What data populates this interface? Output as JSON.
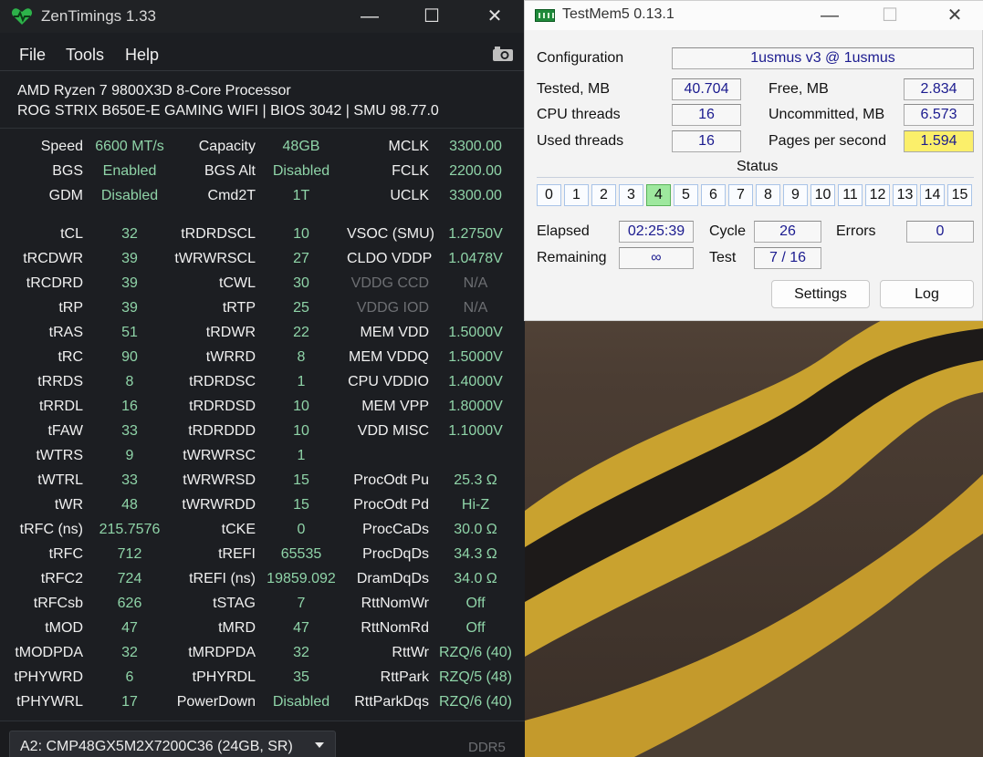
{
  "zentimings": {
    "title": "ZenTimings 1.33",
    "window_controls": {
      "minimize": "—",
      "maximize": "☐",
      "close": "✕"
    },
    "menu": [
      "File",
      "Tools",
      "Help"
    ],
    "cpu_name": "AMD Ryzen 7 9800X3D 8-Core Processor",
    "board_info": "ROG STRIX B650E-E GAMING WIFI | BIOS 3042 | SMU 98.77.0",
    "top_rows": [
      {
        "l1": "Speed",
        "v1": "6600 MT/s",
        "l2": "Capacity",
        "v2": "48GB",
        "l3": "MCLK",
        "v3": "3300.00"
      },
      {
        "l1": "BGS",
        "v1": "Enabled",
        "l2": "BGS Alt",
        "v2": "Disabled",
        "l3": "FCLK",
        "v3": "2200.00"
      },
      {
        "l1": "GDM",
        "v1": "Disabled",
        "l2": "Cmd2T",
        "v2": "1T",
        "l3": "UCLK",
        "v3": "3300.00"
      }
    ],
    "timing_rows": [
      {
        "l1": "tCL",
        "v1": "32",
        "l2": "tRDRDSCL",
        "v2": "10",
        "l3": "VSOC (SMU)",
        "v3": "1.2750V"
      },
      {
        "l1": "tRCDWR",
        "v1": "39",
        "l2": "tWRWRSCL",
        "v2": "27",
        "l3": "CLDO VDDP",
        "v3": "1.0478V"
      },
      {
        "l1": "tRCDRD",
        "v1": "39",
        "l2": "tCWL",
        "v2": "30",
        "l3": "VDDG CCD",
        "v3": "N/A"
      },
      {
        "l1": "tRP",
        "v1": "39",
        "l2": "tRTP",
        "v2": "25",
        "l3": "VDDG IOD",
        "v3": "N/A"
      },
      {
        "l1": "tRAS",
        "v1": "51",
        "l2": "tRDWR",
        "v2": "22",
        "l3": "MEM VDD",
        "v3": "1.5000V"
      },
      {
        "l1": "tRC",
        "v1": "90",
        "l2": "tWRRD",
        "v2": "8",
        "l3": "MEM VDDQ",
        "v3": "1.5000V"
      },
      {
        "l1": "tRRDS",
        "v1": "8",
        "l2": "tRDRDSC",
        "v2": "1",
        "l3": "CPU VDDIO",
        "v3": "1.4000V"
      },
      {
        "l1": "tRRDL",
        "v1": "16",
        "l2": "tRDRDSD",
        "v2": "10",
        "l3": "MEM VPP",
        "v3": "1.8000V"
      },
      {
        "l1": "tFAW",
        "v1": "33",
        "l2": "tRDRDDD",
        "v2": "10",
        "l3": "VDD MISC",
        "v3": "1.1000V"
      },
      {
        "l1": "tWTRS",
        "v1": "9",
        "l2": "tWRWRSC",
        "v2": "1",
        "l3": "",
        "v3": ""
      },
      {
        "l1": "tWTRL",
        "v1": "33",
        "l2": "tWRWRSD",
        "v2": "15",
        "l3": "ProcOdt Pu",
        "v3": "25.3 Ω"
      },
      {
        "l1": "tWR",
        "v1": "48",
        "l2": "tWRWRDD",
        "v2": "15",
        "l3": "ProcOdt Pd",
        "v3": "Hi-Z"
      },
      {
        "l1": "tRFC (ns)",
        "v1": "215.7576",
        "l2": "tCKE",
        "v2": "0",
        "l3": "ProcCaDs",
        "v3": "30.0 Ω"
      },
      {
        "l1": "tRFC",
        "v1": "712",
        "l2": "tREFI",
        "v2": "65535",
        "l3": "ProcDqDs",
        "v3": "34.3 Ω"
      },
      {
        "l1": "tRFC2",
        "v1": "724",
        "l2": "tREFI (ns)",
        "v2": "19859.092",
        "l3": "DramDqDs",
        "v3": "34.0 Ω"
      },
      {
        "l1": "tRFCsb",
        "v1": "626",
        "l2": "tSTAG",
        "v2": "7",
        "l3": "RttNomWr",
        "v3": "Off"
      },
      {
        "l1": "tMOD",
        "v1": "47",
        "l2": "tMRD",
        "v2": "47",
        "l3": "RttNomRd",
        "v3": "Off"
      },
      {
        "l1": "tMODPDA",
        "v1": "32",
        "l2": "tMRDPDA",
        "v2": "32",
        "l3": "RttWr",
        "v3": "RZQ/6 (40)"
      },
      {
        "l1": "tPHYWRD",
        "v1": "6",
        "l2": "tPHYRDL",
        "v2": "35",
        "l3": "RttPark",
        "v3": "RZQ/5 (48)"
      },
      {
        "l1": "tPHYWRL",
        "v1": "17",
        "l2": "PowerDown",
        "v2": "Disabled",
        "l3": "RttParkDqs",
        "v3": "RZQ/6 (40)"
      }
    ],
    "dimm_select": "A2: CMP48GX5M2X7200C36 (24GB, SR)",
    "mem_type": "DDR5"
  },
  "testmem": {
    "title": "TestMem5   0.13.1",
    "window_controls": {
      "minimize": "—",
      "maximize": "☐",
      "close": "✕"
    },
    "configuration_label": "Configuration",
    "configuration_value": "1usmus v3 @ 1usmus",
    "tested_label": "Tested, MB",
    "tested_value": "40.704",
    "free_label": "Free, MB",
    "free_value": "2.834",
    "cpu_threads_label": "CPU threads",
    "cpu_threads_value": "16",
    "uncommitted_label": "Uncommitted, MB",
    "uncommitted_value": "6.573",
    "used_threads_label": "Used threads",
    "used_threads_value": "16",
    "pages_label": "Pages per second",
    "pages_value": "1.594",
    "status_label": "Status",
    "status_cells": [
      "0",
      "1",
      "2",
      "3",
      "4",
      "5",
      "6",
      "7",
      "8",
      "9",
      "10",
      "11",
      "12",
      "13",
      "14",
      "15"
    ],
    "active_cell": 4,
    "elapsed_label": "Elapsed",
    "elapsed_value": "02:25:39",
    "cycle_label": "Cycle",
    "cycle_value": "26",
    "errors_label": "Errors",
    "errors_value": "0",
    "remaining_label": "Remaining",
    "remaining_value": "∞",
    "test_label": "Test",
    "test_value": "7 / 16",
    "settings_button": "Settings",
    "log_button": "Log"
  }
}
